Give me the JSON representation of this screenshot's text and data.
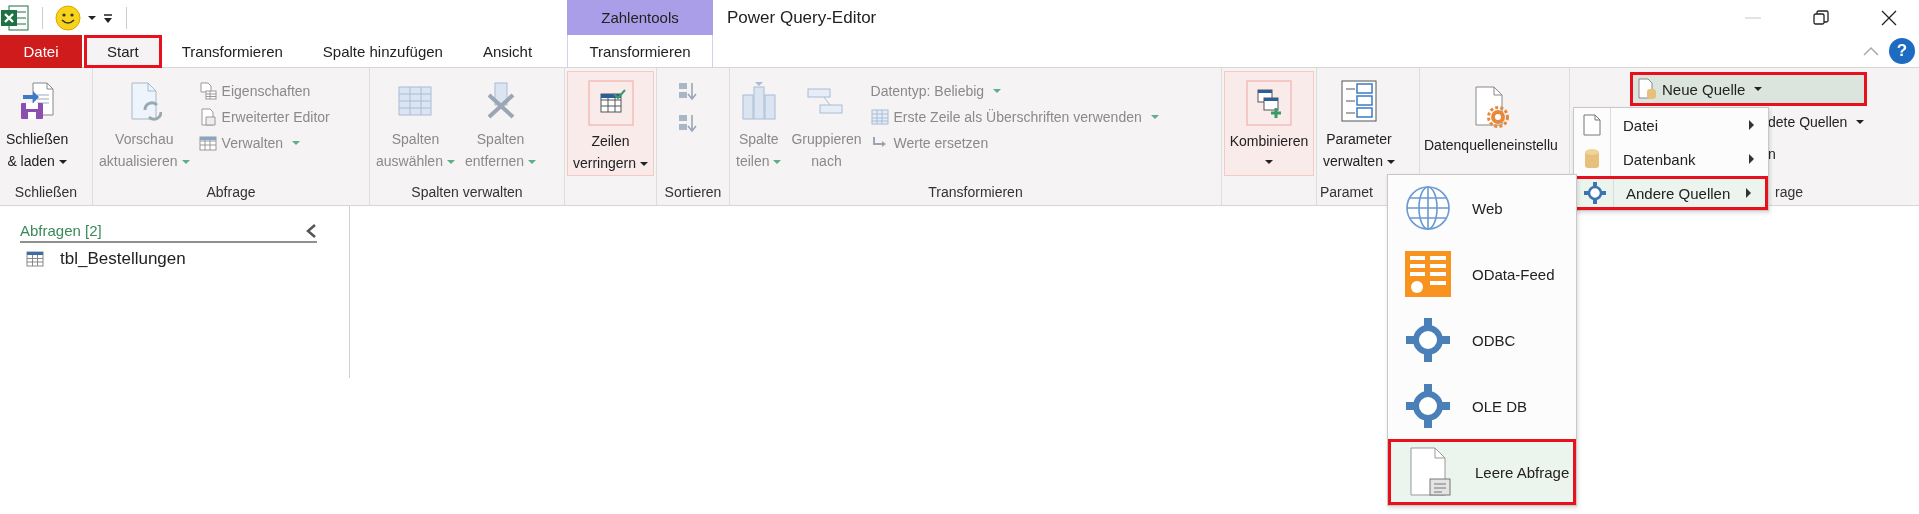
{
  "title_bar": {
    "title": "Power Query-Editor",
    "contextual_header": "Zahlentools",
    "help": "?"
  },
  "tabs": [
    {
      "label": "Datei",
      "kind": "file",
      "selected": false,
      "annotated": false
    },
    {
      "label": "Start",
      "kind": "normal",
      "selected": true,
      "annotated": true
    },
    {
      "label": "Transformieren",
      "kind": "normal",
      "selected": false,
      "annotated": false
    },
    {
      "label": "Spalte hinzufügen",
      "kind": "normal",
      "selected": false,
      "annotated": false
    },
    {
      "label": "Ansicht",
      "kind": "normal",
      "selected": false,
      "annotated": false
    },
    {
      "label": "Transformieren",
      "kind": "contextual",
      "selected": false,
      "annotated": false
    }
  ],
  "ribbon": {
    "groups": [
      {
        "label": "Schließen",
        "controls": [
          {
            "kind": "large",
            "label": "Schließen\n& laden",
            "dropdown": true,
            "disabled": false,
            "highlighted": false
          }
        ]
      },
      {
        "label": "Abfrage",
        "controls": [
          {
            "kind": "large",
            "label": "Vorschau\naktualisieren",
            "dropdown": true,
            "disabled": true,
            "highlighted": false
          },
          {
            "kind": "stack",
            "items": [
              {
                "kind": "item",
                "label": "Eigenschaften",
                "dropdown": false,
                "disabled": true,
                "annotated": false
              },
              {
                "kind": "item",
                "label": "Erweiterter Editor",
                "dropdown": false,
                "disabled": true,
                "annotated": false
              },
              {
                "kind": "item",
                "label": "Verwalten",
                "dropdown": true,
                "disabled": true,
                "annotated": false
              }
            ]
          }
        ]
      },
      {
        "label": "Spalten verwalten",
        "controls": [
          {
            "kind": "large",
            "label": "Spalten\nauswählen",
            "dropdown": true,
            "disabled": true,
            "highlighted": false
          },
          {
            "kind": "large",
            "label": "Spalten\nentfernen",
            "dropdown": true,
            "disabled": true,
            "highlighted": false
          }
        ]
      },
      {
        "controls": [
          {
            "kind": "large",
            "label": "Zeilen\nverringern",
            "dropdown": true,
            "disabled": false,
            "highlighted": true
          }
        ]
      },
      {
        "label": "Sortieren",
        "controls": [
          {
            "kind": "icons",
            "items": [
              {
                "disabled": true
              },
              {
                "disabled": true
              }
            ]
          }
        ]
      },
      {
        "label": "Transformieren",
        "controls": [
          {
            "kind": "large",
            "label": "Spalte\nteilen",
            "dropdown": true,
            "disabled": true,
            "highlighted": false
          },
          {
            "kind": "large",
            "label": "Gruppieren\nnach",
            "dropdown": false,
            "disabled": true,
            "highlighted": false
          },
          {
            "kind": "stack",
            "items": [
              {
                "kind": "text",
                "label": "Datentyp: Beliebig",
                "dropdown": true,
                "disabled": true,
                "annotated": false
              },
              {
                "kind": "item",
                "label": "Erste Zeile als Überschriften verwenden",
                "dropdown": true,
                "disabled": true,
                "annotated": false
              },
              {
                "kind": "item",
                "label": "Werte ersetzen",
                "dropdown": false,
                "disabled": true,
                "annotated": false
              }
            ]
          }
        ]
      },
      {
        "controls": [
          {
            "kind": "large",
            "label": "Kombinieren",
            "dropdown": true,
            "disabled": false,
            "highlighted": true
          }
        ]
      },
      {
        "label": "Paramet",
        "controls": [
          {
            "kind": "large",
            "label": "Parameter\nverwalten",
            "dropdown": true,
            "disabled": false,
            "highlighted": false
          }
        ]
      },
      {
        "controls": [
          {
            "kind": "large",
            "label": "Datenquelleneinstellu",
            "dropdown": false,
            "disabled": false,
            "highlighted": false
          }
        ]
      },
      {
        "label": "rage",
        "controls": [
          {
            "kind": "stack",
            "items": [
              {
                "kind": "item",
                "label": "Neue Quelle",
                "dropdown": true,
                "disabled": false,
                "annotated": true
              },
              {
                "kind": "text",
                "label": "dete Quellen",
                "dropdown": true,
                "disabled": false,
                "annotated": false
              },
              {
                "kind": "text",
                "label": "n",
                "dropdown": false,
                "disabled": false,
                "annotated": false
              }
            ]
          }
        ]
      }
    ]
  },
  "queries_pane": {
    "header": "Abfragen [2]",
    "items": [
      {
        "label": "tbl_Bestellungen",
        "selected": false
      }
    ]
  },
  "menus": [
    {
      "items": [
        {
          "label": "Datei",
          "submenu": true,
          "hovered": false,
          "annotated": false
        },
        {
          "label": "Datenbank",
          "submenu": true,
          "hovered": false,
          "annotated": false
        },
        {
          "label": "Andere Quellen",
          "submenu": true,
          "hovered": true,
          "annotated": true
        }
      ]
    },
    {
      "items": [
        {
          "label": "Web",
          "submenu": false,
          "hovered": false,
          "annotated": false
        },
        {
          "label": "OData-Feed",
          "submenu": false,
          "hovered": false,
          "annotated": false
        },
        {
          "label": "ODBC",
          "submenu": false,
          "hovered": false,
          "annotated": false
        },
        {
          "label": "OLE DB",
          "submenu": false,
          "hovered": false,
          "annotated": false
        },
        {
          "label": "Leere Abfrage",
          "submenu": false,
          "hovered": true,
          "annotated": true
        }
      ]
    }
  ]
}
